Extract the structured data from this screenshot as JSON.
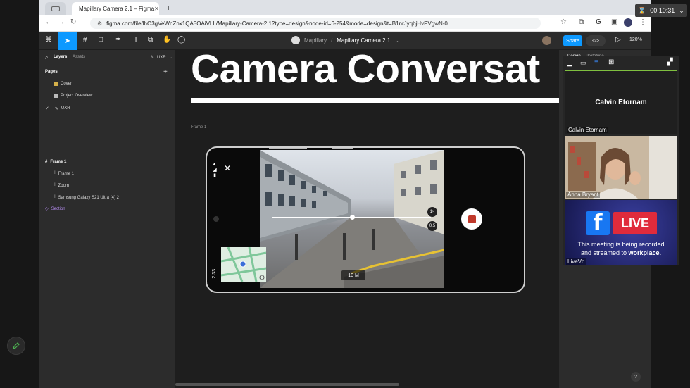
{
  "browser": {
    "tab_title": "Mapillary Camera 2.1 – Figma",
    "new_tab": "+",
    "url": "figma.com/file/lhO3gVeWnZnx1QA5OAiVLL/Mapillary-Camera-2.1?type=design&node-id=6-254&mode=design&t=B1nrJyqbjHvPVgwN-0"
  },
  "figma": {
    "breadcrumb_team": "Mapillary",
    "breadcrumb_sep": "/",
    "file_name": "Mapillary Camera 2.1",
    "share_label": "Share",
    "zoom": "120%",
    "left_tabs": {
      "layers": "Layers",
      "assets": "Assets",
      "page_picker": "UXR"
    },
    "pages_heading": "Pages",
    "pages": [
      {
        "label": "Cover",
        "checked": false
      },
      {
        "label": "Project Overview",
        "checked": false
      },
      {
        "label": "UXR",
        "checked": true
      }
    ],
    "layers": [
      "Frame 1",
      "Frame 1",
      "Zoom",
      "Samsung Galaxy S21 Ultra (4) 2",
      "Section"
    ],
    "right_tabs": [
      "Design",
      "Prototype"
    ]
  },
  "canvas": {
    "big_title": "Camera Conversat",
    "frame_label": "Frame 1",
    "phone": {
      "time": "2:33",
      "distance": "10 M",
      "zoom_1x": "1×",
      "zoom_05": "0.5"
    }
  },
  "video": {
    "participants": [
      {
        "name": "Calvin Etornam",
        "center_label": "Calvin Etornam"
      },
      {
        "name": "Anna Bryant"
      },
      {
        "name": "LiveVc",
        "live_label": "LIVE",
        "notice_line1": "This meeting is being recorded",
        "notice_line2": "and streamed to",
        "brand": "workplace."
      }
    ],
    "timer": "00:10:31"
  },
  "colors": {
    "accent": "#0d99ff",
    "live_red": "#e02b3c",
    "facebook": "#1877f2",
    "record_red": "#c0392b"
  }
}
